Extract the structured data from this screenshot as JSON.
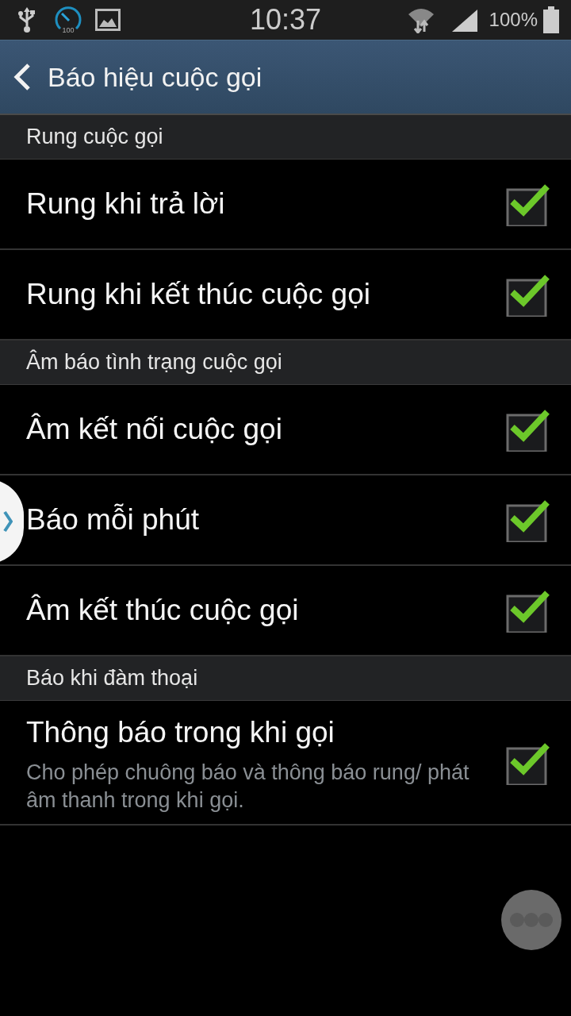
{
  "status_bar": {
    "time": "10:37",
    "gauge_label": "100",
    "battery": "100%"
  },
  "header": {
    "title": "Báo hiệu cuộc gọi"
  },
  "sections": [
    {
      "title": "Rung cuộc gọi",
      "items": [
        {
          "label": "Rung khi trả lời",
          "checked": true
        },
        {
          "label": "Rung khi kết thúc cuộc gọi",
          "checked": true
        }
      ]
    },
    {
      "title": "Âm báo tình trạng cuộc gọi",
      "items": [
        {
          "label": "Âm kết nối cuộc gọi",
          "checked": true
        },
        {
          "label": "Báo mỗi phút",
          "checked": true
        },
        {
          "label": "Âm kết thúc cuộc gọi",
          "checked": true
        }
      ]
    },
    {
      "title": "Báo khi đàm thoại",
      "items": [
        {
          "label": "Thông báo trong khi gọi",
          "summary": "Cho phép chuông báo và thông báo rung/ phát âm thanh trong khi gọi.",
          "checked": true
        }
      ]
    }
  ]
}
